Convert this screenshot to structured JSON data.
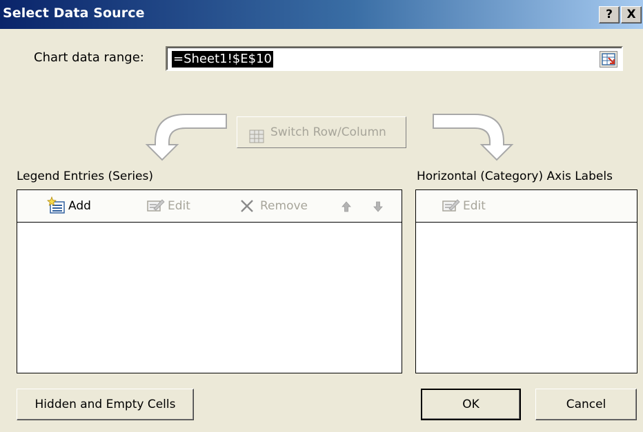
{
  "window": {
    "title": "Select Data Source",
    "help_label": "?",
    "close_label": "X"
  },
  "range": {
    "label": "Chart data range:",
    "value": "=Sheet1!$E$10"
  },
  "switch_button": {
    "label": "Switch Row/Column",
    "enabled": false
  },
  "legend": {
    "title": "Legend Entries (Series)",
    "toolbar": {
      "add": "Add",
      "edit": "Edit",
      "remove": "Remove"
    },
    "items": []
  },
  "axis": {
    "title": "Horizontal (Category) Axis Labels",
    "toolbar": {
      "edit": "Edit"
    },
    "items": []
  },
  "buttons": {
    "hidden_empty": "Hidden and Empty Cells",
    "ok": "OK",
    "cancel": "Cancel"
  },
  "icons": {
    "add": "add-series-icon",
    "edit": "edit-icon",
    "remove": "remove-x-icon",
    "move_up": "arrow-up-icon",
    "move_down": "arrow-down-icon",
    "collapse": "collapse-dialog-icon",
    "switch": "switch-row-column-icon"
  },
  "colors": {
    "titlebar_start": "#0a246a",
    "titlebar_end": "#a6caf0",
    "dialog_bg": "#ece9d8",
    "disabled_text": "#a7a59a",
    "selection_bg": "#000000"
  }
}
